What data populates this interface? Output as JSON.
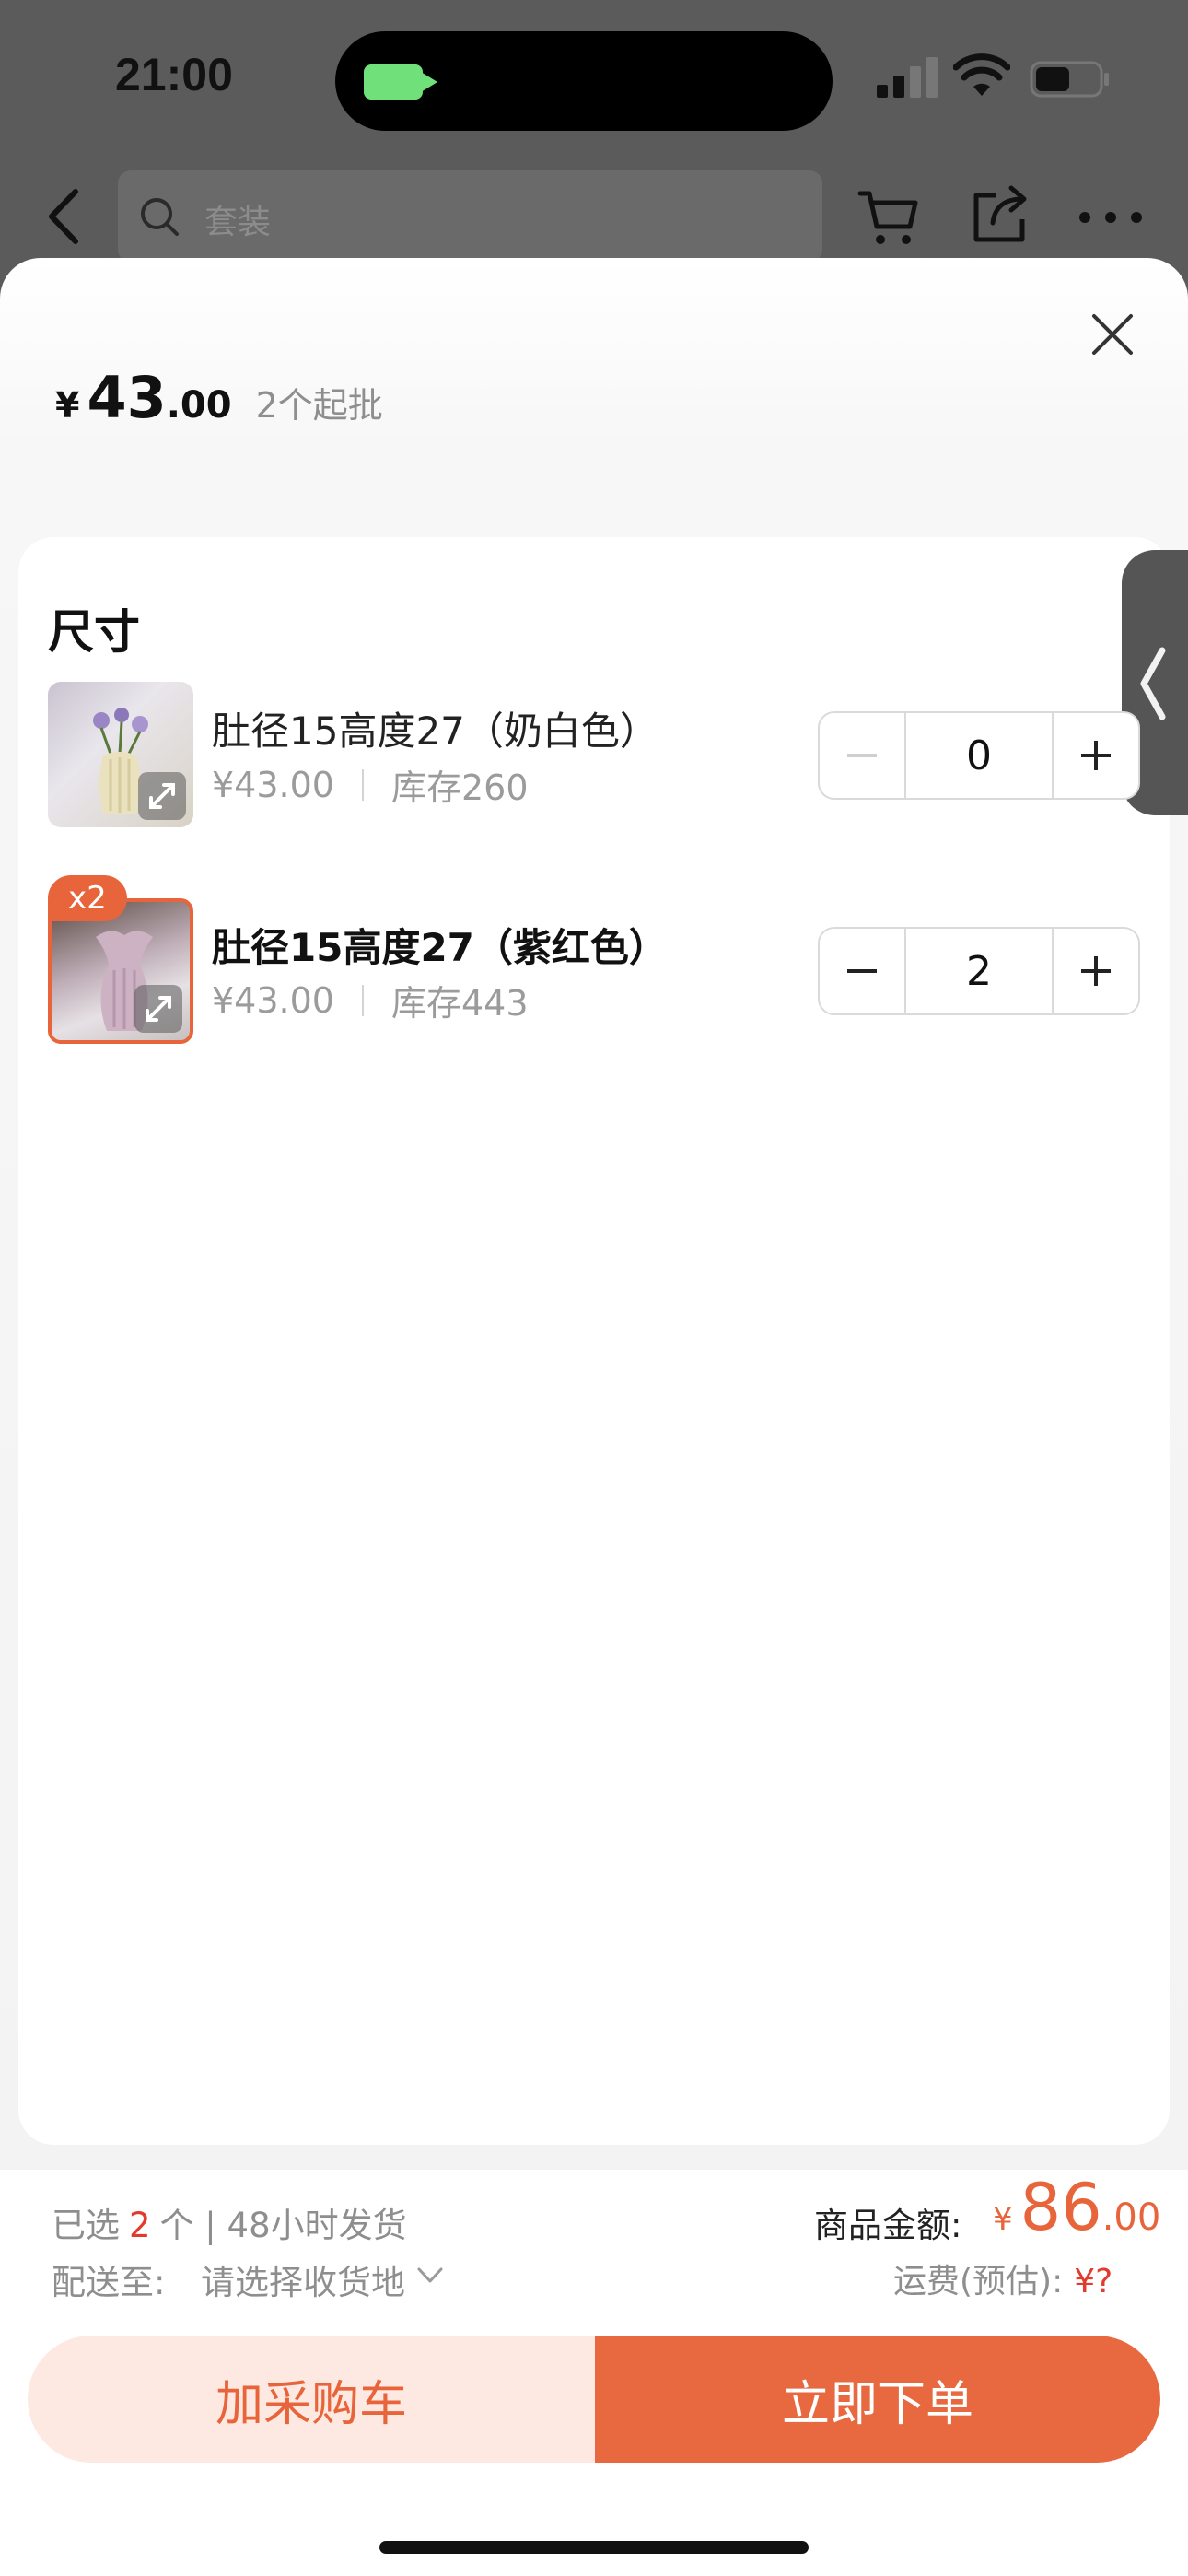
{
  "status_bar": {
    "time": "21:00"
  },
  "nav": {
    "search_placeholder": "套装"
  },
  "sheet": {
    "price": {
      "currency": "¥",
      "integer": "43",
      "decimal": ".00",
      "moq": "2个起批"
    },
    "section_title": "尺寸",
    "items": [
      {
        "name": "肚径15高度27（奶白色）",
        "price": "¥43.00",
        "stock": "库存260",
        "quantity": "0",
        "selected": false
      },
      {
        "name": "肚径15高度27（紫红色）",
        "price": "¥43.00",
        "stock": "库存443",
        "quantity": "2",
        "selected": true,
        "badge": "x2"
      }
    ]
  },
  "summary": {
    "selected_prefix": "已选",
    "selected_count": "2",
    "selected_suffix": "个 | 48小时发货",
    "ship_to_label": "配送至:",
    "ship_to_value": "请选择收货地",
    "total_label": "商品金额:",
    "total_currency": "¥",
    "total_integer": "86",
    "total_decimal": ".00",
    "freight_label": "运费(预估):",
    "freight_value": "¥?"
  },
  "actions": {
    "add_to_cart": "加采购车",
    "buy_now": "立即下单"
  },
  "colors": {
    "accent": "#e8643a",
    "red": "#e23a2c",
    "cart_bg": "#fde9e1"
  }
}
